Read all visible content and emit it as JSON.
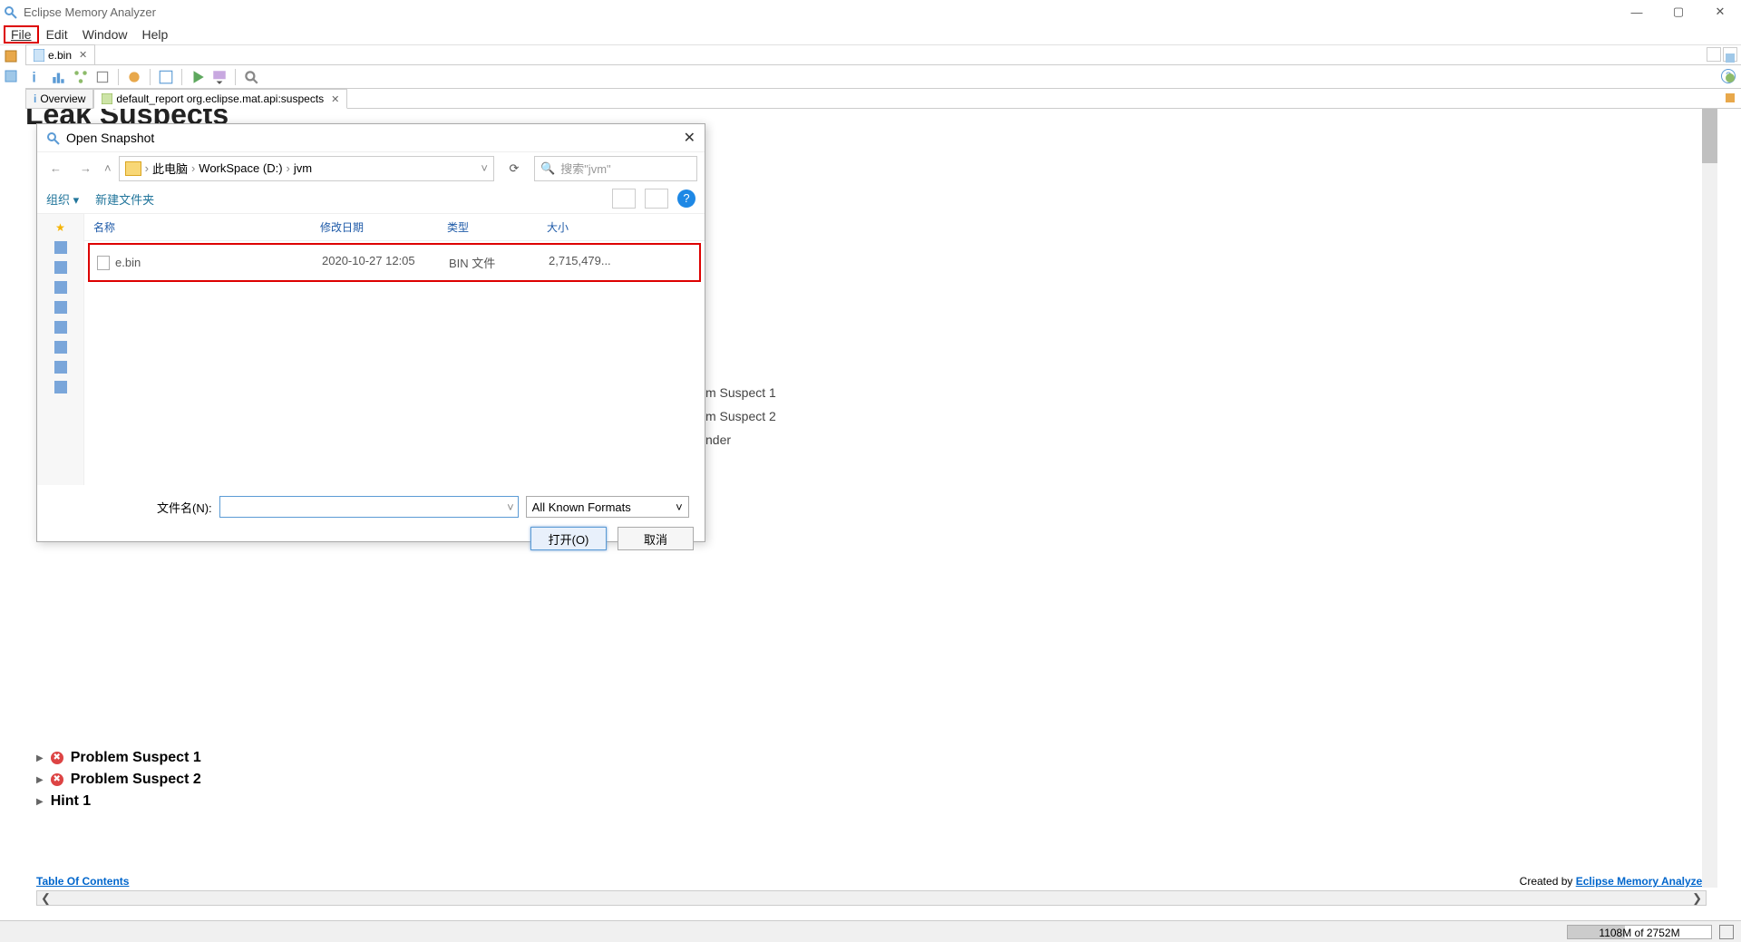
{
  "window": {
    "title": "Eclipse Memory Analyzer",
    "controls": {
      "min": "—",
      "max": "▢",
      "close": "✕"
    }
  },
  "menubar": {
    "file": "File",
    "edit": "Edit",
    "window": "Window",
    "help": "Help"
  },
  "editor_tab": {
    "label": "e.bin",
    "close": "✕"
  },
  "subtabs": {
    "overview": {
      "icon": "i",
      "label": "Overview"
    },
    "report": {
      "label": "default_report org.eclipse.mat.api:suspects",
      "close": "✕"
    }
  },
  "content": {
    "title": "Leak Suspects",
    "bg_lines": [
      "m Suspect 1",
      "m Suspect 2",
      "nder"
    ],
    "tree": {
      "r1": "Problem Suspect 1",
      "r2": "Problem Suspect 2",
      "r3": "Hint 1"
    },
    "footer": {
      "toc": "Table Of Contents",
      "created_prefix": "Created by ",
      "created_link": "Eclipse Memory Analyzer"
    }
  },
  "dialog": {
    "title": "Open Snapshot",
    "breadcrumb": {
      "p1": "此电脑",
      "p2": "WorkSpace (D:)",
      "p3": "jvm",
      "sep": "›"
    },
    "search_placeholder": "搜索\"jvm\"",
    "toolbar": {
      "org": "组织",
      "newf": "新建文件夹"
    },
    "headers": {
      "name": "名称",
      "date": "修改日期",
      "type": "类型",
      "size": "大小"
    },
    "row": {
      "name": "e.bin",
      "date": "2020-10-27 12:05",
      "type": "BIN 文件",
      "size": "2,715,479..."
    },
    "filename_label": "文件名(N):",
    "filter": "All Known Formats",
    "open": "打开(O)",
    "cancel": "取消"
  },
  "statusbar": {
    "mem": "1108M of 2752M"
  }
}
